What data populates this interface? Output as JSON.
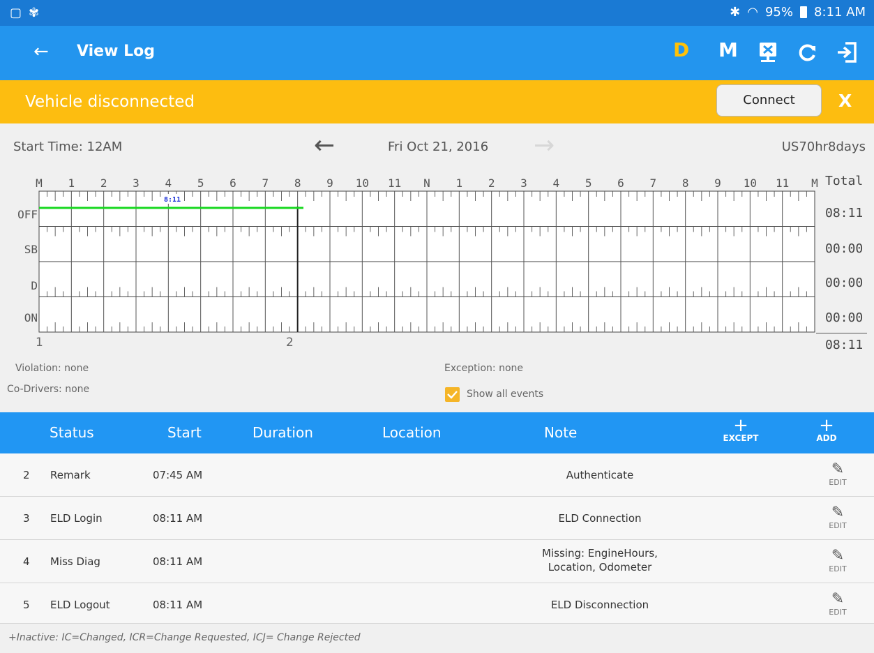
{
  "status_bar": {
    "left_icons": [
      "screenshot-icon",
      "pinwheel-icon"
    ],
    "bluetooth": "✱",
    "battery": "95%",
    "time": "8:11 AM"
  },
  "app_bar": {
    "title": "View Log",
    "actions": [
      "D",
      "M"
    ]
  },
  "banner": {
    "message": "Vehicle disconnected",
    "connect_label": "Connect",
    "close_label": "X"
  },
  "log_header": {
    "start_time": "Start Time: 12AM",
    "date": "Fri Oct 21, 2016",
    "rule": "US70hr8days"
  },
  "grid": {
    "hour_labels": [
      "M",
      "1",
      "2",
      "3",
      "4",
      "5",
      "6",
      "7",
      "8",
      "9",
      "10",
      "11",
      "N",
      "1",
      "2",
      "3",
      "4",
      "5",
      "6",
      "7",
      "8",
      "9",
      "10",
      "11",
      "M"
    ],
    "rows": [
      "OFF",
      "SB",
      "D",
      "ON"
    ],
    "totals_header": "Total",
    "totals": [
      "08:11",
      "00:00",
      "00:00",
      "00:00"
    ],
    "grand_total": "08:11",
    "marker_label": "8:11",
    "below_numbers": [
      "1",
      "2"
    ],
    "segments": [
      {
        "status": "OFF",
        "start_hour": 0,
        "end_hour": 8.18
      }
    ],
    "current_hour": 8.0,
    "accent_green": "#18d820"
  },
  "info": {
    "violation": "Violation: none",
    "co_drivers": "Co-Drivers: none",
    "exception": "Exception: none",
    "show_all_events": "Show all events"
  },
  "table": {
    "headers": {
      "status": "Status",
      "start": "Start",
      "duration": "Duration",
      "location": "Location",
      "note": "Note"
    },
    "except_label": "EXCEPT",
    "add_label": "ADD",
    "rows": [
      {
        "num": "2",
        "status": "Remark",
        "start": "07:45 AM",
        "note": "Authenticate",
        "edit": "EDIT"
      },
      {
        "num": "3",
        "status": "ELD Login",
        "start": "08:11 AM",
        "note": "ELD Connection",
        "edit": "EDIT"
      },
      {
        "num": "4",
        "status": "Miss Diag",
        "start": "08:11 AM",
        "note": "Missing: EngineHours,",
        "note2": "Location, Odometer",
        "edit": "EDIT"
      },
      {
        "num": "5",
        "status": "ELD Logout",
        "start": "08:11 AM",
        "note": "ELD Disconnection",
        "edit": "EDIT"
      }
    ],
    "footer": "+Inactive: IC=Changed, ICR=Change Requested, ICJ= Change Rejected"
  },
  "colors": {
    "primary": "#2196f3",
    "banner": "#fdbd10",
    "driving_accent": "#ffc107"
  }
}
